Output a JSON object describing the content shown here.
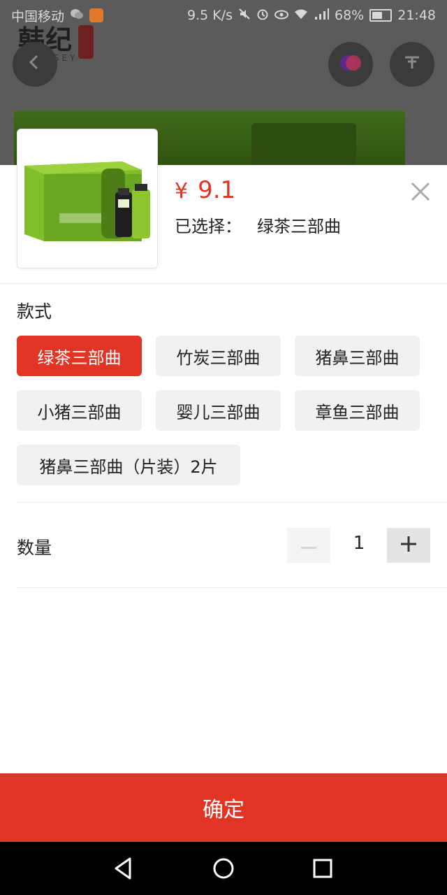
{
  "status_bar": {
    "carrier": "中国移动",
    "net_speed": "9.5 K/s",
    "battery_pct": "68%",
    "time": "21:48"
  },
  "background": {
    "brand_logo_text": "韩纪",
    "brand_sub": "KANSEY"
  },
  "product": {
    "currency_symbol": "¥",
    "price": "9.1",
    "selected_label": "已选择：",
    "selected_value": "绿茶三部曲"
  },
  "style_section": {
    "title": "款式",
    "options": [
      {
        "label": "绿茶三部曲",
        "active": true
      },
      {
        "label": "竹炭三部曲",
        "active": false
      },
      {
        "label": "猪鼻三部曲",
        "active": false
      },
      {
        "label": "小猪三部曲",
        "active": false
      },
      {
        "label": "婴儿三部曲",
        "active": false
      },
      {
        "label": "章鱼三部曲",
        "active": false
      },
      {
        "label": "猪鼻三部曲（片装）2片",
        "active": false
      }
    ]
  },
  "quantity_section": {
    "title": "数量",
    "value": "1"
  },
  "confirm_label": "确定",
  "colors": {
    "accent": "#e03524",
    "chip_bg": "#f1f1f1",
    "text": "#222222"
  }
}
